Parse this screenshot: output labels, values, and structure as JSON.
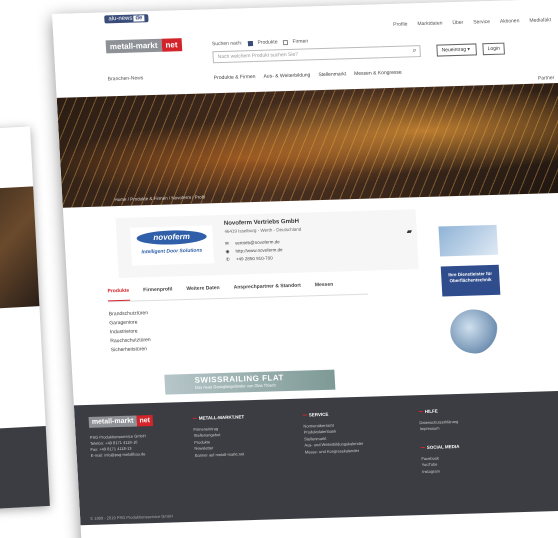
{
  "topbar": {
    "badge_text": "alu-news",
    "badge_suffix": "de"
  },
  "header": {
    "logo_left": "metall-markt",
    "logo_right": "net",
    "top_nav": [
      "Profile",
      "Marktdaten",
      "Über",
      "Service",
      "Aktionen",
      "Mediafakt"
    ],
    "search_label": "Suchen nach:",
    "checkbox_products": "Produkte",
    "checkbox_firms": "Firmen",
    "search_placeholder": "Nach welchem Produkt suchen Sie?",
    "new_button": "Neueintrag",
    "login_button": "Login",
    "brands_label": "Branchen-News",
    "main_nav": [
      "Produkte & Firmen",
      "Aus- & Weiterbildung",
      "Stellenmarkt",
      "Messen & Kongresse"
    ],
    "partner_label": "Partner"
  },
  "breadcrumb": "Home / Produkte & Firmen / Novoferm / Profil",
  "company": {
    "logo_word": "novoferm",
    "logo_tagline": "Intelligent Door Solutions",
    "name": "Novoferm Vertriebs GmbH",
    "address": "46419 Isselburg - Werth - Deutschland",
    "email": "vertrieb@novoferm.de",
    "web": "http://www.novoferm.de",
    "phone": "+49 2850 910-700"
  },
  "tabs": [
    "Produkte",
    "Firmenprofil",
    "Weitere Daten",
    "Ansprechpartner & Standort",
    "Messen"
  ],
  "products": [
    "Brandschutztüren",
    "Garagentore",
    "Industrietore",
    "Rauchschutztüren",
    "Sicherheitstüren"
  ],
  "ads": {
    "ad2_text": "Ihre Dienstleister für Oberflächentechnik",
    "banner_title": "SWISSRAILING FLAT",
    "banner_sub": "Das neue Ganzglasgeländer von Glas Trösch"
  },
  "footer": {
    "logo_left": "metall-markt",
    "logo_right": "net",
    "address_lines": [
      "PSG Produktionsservice GmbH",
      "Telefon: +49 8171 4118-10",
      "Fax: +49 8171 4118-13",
      "E-mail: info@psg-metallbau.de"
    ],
    "col1_title": "METALL-MARKT.NET",
    "col1_items": [
      "Firmeneintrag",
      "Stellenangebot",
      "Produkte",
      "Newsletter",
      "Banner auf metall-markt.net"
    ],
    "col2_title": "SERVICE",
    "col2_items": [
      "Normenübersicht",
      "Produktdatenbank",
      "Stellenmarkt",
      "Aus- und Weiterbildungskalender",
      "Messe- und Kongresskalender"
    ],
    "col3_title": "HILFE",
    "col3_items": [
      "Datenschutzerklärung",
      "Impressum"
    ],
    "col4_title": "SOCIAL MEDIA",
    "col4_items": [
      "Facebook",
      "YouTube",
      "Instagram"
    ],
    "copyright": "© 1999 - 2019 PSG Produktionsservice GmbH"
  }
}
